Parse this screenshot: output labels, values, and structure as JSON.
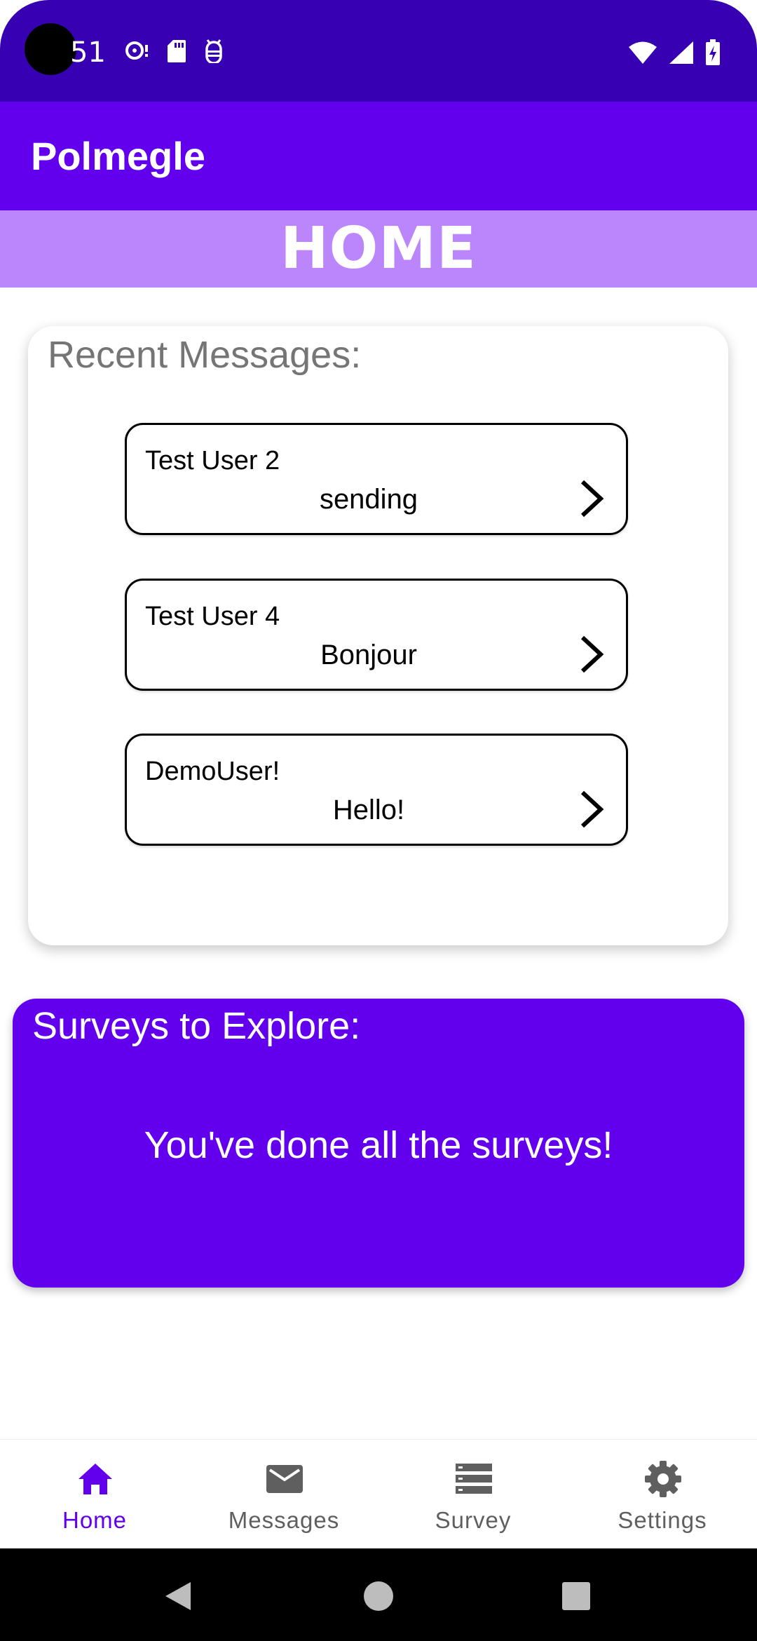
{
  "status_bar": {
    "time": "51",
    "notification_icons": [
      "sync-alert-icon",
      "sd-card-icon",
      "android-debug-icon"
    ],
    "system_icons": [
      "wifi-icon",
      "cellular-signal-icon",
      "battery-charging-icon"
    ]
  },
  "app_bar": {
    "title": "Polmegle"
  },
  "banner": {
    "title": "HOME"
  },
  "recent_messages": {
    "title": "Recent Messages:",
    "items": [
      {
        "user": "Test User 2",
        "message": "sending"
      },
      {
        "user": "Test User 4",
        "message": "Bonjour"
      },
      {
        "user": "DemoUser!",
        "message": "Hello!"
      }
    ]
  },
  "surveys": {
    "title": "Surveys to Explore:",
    "empty_text": "You've done all the surveys!"
  },
  "bottom_nav": {
    "items": [
      {
        "label": "Home",
        "icon": "home-icon",
        "active": true
      },
      {
        "label": "Messages",
        "icon": "mail-icon",
        "active": false
      },
      {
        "label": "Survey",
        "icon": "list-icon",
        "active": false
      },
      {
        "label": "Settings",
        "icon": "gear-icon",
        "active": false
      }
    ]
  },
  "colors": {
    "status_bar": "#3700b3",
    "primary": "#6200ee",
    "banner": "#bb86fc",
    "nav_inactive": "#5f5f5f"
  }
}
